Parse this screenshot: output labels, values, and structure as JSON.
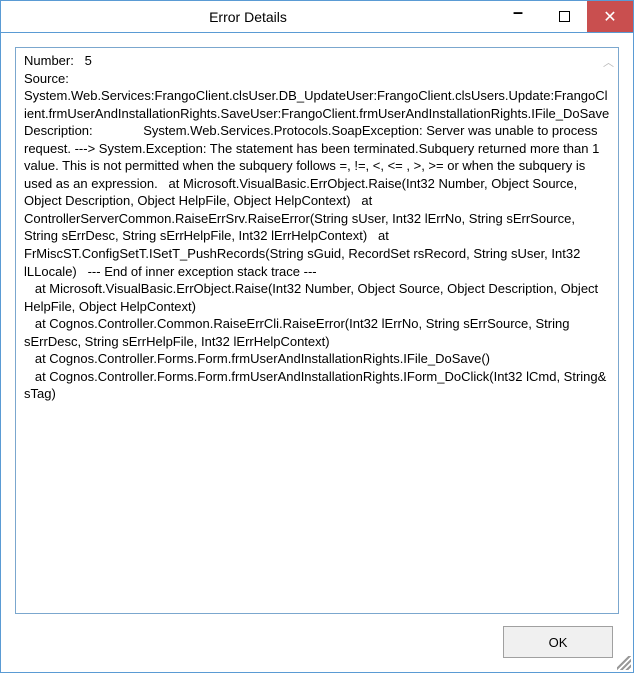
{
  "window": {
    "title": "Error Details"
  },
  "error": {
    "body": "Number:   5\nSource:  System.Web.Services:FrangoClient.clsUser.DB_UpdateUser:FrangoClient.clsUsers.Update:FrangoClient.frmUserAndInstallationRights.SaveUser:FrangoClient.frmUserAndInstallationRights.IFile_DoSave\nDescription:              System.Web.Services.Protocols.SoapException: Server was unable to process request. ---> System.Exception: The statement has been terminated.Subquery returned more than 1 value. This is not permitted when the subquery follows =, !=, <, <= , >, >= or when the subquery is used as an expression.   at Microsoft.VisualBasic.ErrObject.Raise(Int32 Number, Object Source, Object Description, Object HelpFile, Object HelpContext)   at ControllerServerCommon.RaiseErrSrv.RaiseError(String sUser, Int32 lErrNo, String sErrSource, String sErrDesc, String sErrHelpFile, Int32 lErrHelpContext)   at FrMiscST.ConfigSetT.ISetT_PushRecords(String sGuid, RecordSet rsRecord, String sUser, Int32 lLLocale)   --- End of inner exception stack trace ---\n   at Microsoft.VisualBasic.ErrObject.Raise(Int32 Number, Object Source, Object Description, Object HelpFile, Object HelpContext)\n   at Cognos.Controller.Common.RaiseErrCli.RaiseError(Int32 lErrNo, String sErrSource, String sErrDesc, String sErrHelpFile, Int32 lErrHelpContext)\n   at Cognos.Controller.Forms.Form.frmUserAndInstallationRights.IFile_DoSave()\n   at Cognos.Controller.Forms.Form.frmUserAndInstallationRights.IForm_DoClick(Int32 lCmd, String& sTag)"
  },
  "buttons": {
    "ok_label": "OK"
  }
}
